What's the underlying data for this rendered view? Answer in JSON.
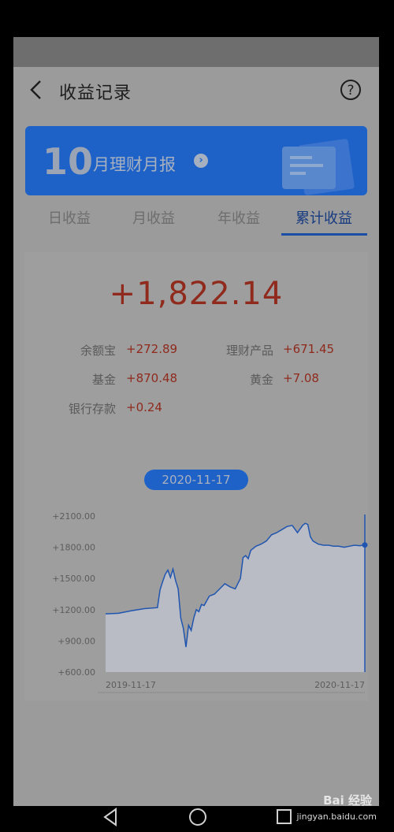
{
  "header": {
    "title": "收益记录",
    "back_icon": "back-arrow-icon",
    "help_icon": "question-mark-icon"
  },
  "banner": {
    "month_number": "10",
    "text": "月理财月报",
    "arrow_icon": "chevron-right-circle-icon"
  },
  "tabs": [
    {
      "label": "日收益",
      "active": false
    },
    {
      "label": "月收益",
      "active": false
    },
    {
      "label": "年收益",
      "active": false
    },
    {
      "label": "累计收益",
      "active": true
    }
  ],
  "summary": {
    "total": "+1,822.14",
    "items": [
      {
        "label": "余额宝",
        "value": "+272.89"
      },
      {
        "label": "理财产品",
        "value": "+671.45"
      },
      {
        "label": "基金",
        "value": "+870.48"
      },
      {
        "label": "黄金",
        "value": "+7.08"
      },
      {
        "label": "银行存款",
        "value": "+0.24"
      }
    ]
  },
  "chart_data": {
    "type": "area",
    "selected_date": "2020-11-17",
    "y_ticks": [
      "+2100.00",
      "+1800.00",
      "+1500.00",
      "+1200.00",
      "+900.00",
      "+600.00"
    ],
    "ylim": [
      600,
      2100
    ],
    "x_tick_labels": [
      "2019-11-17",
      "2020-11-17"
    ],
    "x": [
      0,
      5,
      10,
      15,
      20,
      21,
      22,
      23,
      24,
      25,
      26,
      27,
      28,
      29,
      30,
      31,
      32,
      33,
      34,
      35,
      36,
      37,
      38,
      40,
      42,
      44,
      46,
      48,
      50,
      52,
      53,
      54,
      55,
      56,
      58,
      60,
      62,
      64,
      66,
      68,
      70,
      72,
      74,
      76,
      77,
      78,
      79,
      80,
      82,
      84,
      86,
      88,
      90,
      92,
      94,
      96,
      98,
      100
    ],
    "values": [
      1160,
      1165,
      1190,
      1210,
      1220,
      1390,
      1470,
      1540,
      1580,
      1510,
      1590,
      1480,
      1400,
      1120,
      1020,
      840,
      1050,
      1000,
      1120,
      1200,
      1180,
      1250,
      1240,
      1330,
      1350,
      1400,
      1450,
      1420,
      1400,
      1500,
      1700,
      1720,
      1690,
      1770,
      1810,
      1830,
      1860,
      1920,
      1940,
      1970,
      2000,
      2010,
      1940,
      2010,
      2030,
      2020,
      1900,
      1860,
      1830,
      1820,
      1820,
      1810,
      1810,
      1800,
      1810,
      1820,
      1815,
      1822
    ],
    "series_color": "#1f55b0",
    "fill_color": "#b9bcc5",
    "selected_marker": "vertical-line-with-dot"
  },
  "nav": {
    "back_icon": "triangle-back-icon",
    "home_icon": "circle-home-icon",
    "recent_icon": "square-recents-icon"
  },
  "watermark": {
    "brand": "Bai 经验",
    "site": "jingyan.baidu.com"
  }
}
